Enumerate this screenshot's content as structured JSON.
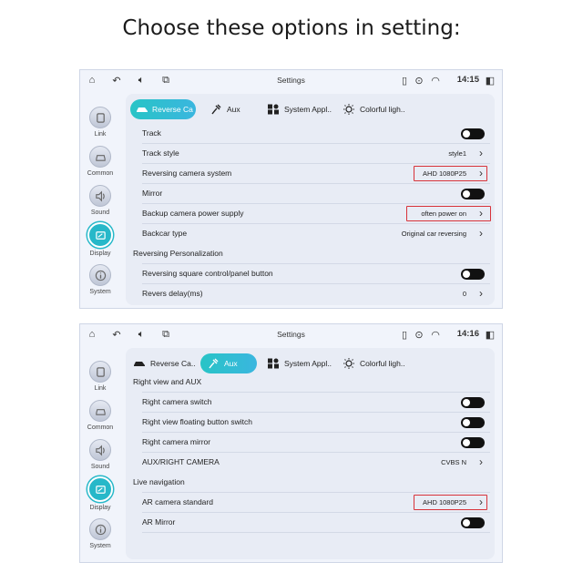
{
  "caption": "Choose these options in setting:",
  "colors": {
    "accent": "#27b8c9",
    "highlight": "#d8333a"
  },
  "sidebar": [
    {
      "label": "Link",
      "icon": "link-icon"
    },
    {
      "label": "Common",
      "icon": "car-icon"
    },
    {
      "label": "Sound",
      "icon": "speaker-icon"
    },
    {
      "label": "Display",
      "icon": "display-icon",
      "active": true
    },
    {
      "label": "System",
      "icon": "info-icon"
    }
  ],
  "screens": [
    {
      "status": {
        "title": "Settings",
        "time": "14:15"
      },
      "tabs": [
        {
          "label": "Reverse Ca",
          "icon": "car-icon",
          "active": true
        },
        {
          "label": "Aux",
          "icon": "plug-icon"
        },
        {
          "label": "System Appl..",
          "icon": "apps-icon"
        },
        {
          "label": "Colorful ligh..",
          "icon": "light-icon"
        }
      ],
      "rows": [
        {
          "label": "Track",
          "control": "toggle"
        },
        {
          "label": "Track style",
          "value": "style1",
          "control": "chevron"
        },
        {
          "label": "Reversing camera system",
          "value": "AHD 1080P25",
          "control": "chevron",
          "highlighted": true
        },
        {
          "label": "Mirror",
          "control": "toggle"
        },
        {
          "label": "Backup camera power supply",
          "value": "often power on",
          "control": "chevron",
          "highlighted": true
        },
        {
          "label": "Backcar type",
          "value": "Original car reversing",
          "control": "chevron"
        },
        {
          "label": "Reversing Personalization",
          "section": true
        },
        {
          "label": "Reversing square control/panel button",
          "control": "toggle"
        },
        {
          "label": "Revers delay(ms)",
          "value": "0",
          "control": "chevron"
        }
      ]
    },
    {
      "status": {
        "title": "Settings",
        "time": "14:16"
      },
      "tabs": [
        {
          "label": "Reverse Ca..",
          "icon": "car-icon"
        },
        {
          "label": "Aux",
          "icon": "plug-icon",
          "active": true
        },
        {
          "label": "System Appl..",
          "icon": "apps-icon"
        },
        {
          "label": "Colorful ligh..",
          "icon": "light-icon"
        }
      ],
      "rows": [
        {
          "label": "Right view and AUX",
          "section": true
        },
        {
          "label": "Right camera switch",
          "control": "toggle"
        },
        {
          "label": "Right view floating button switch",
          "control": "toggle"
        },
        {
          "label": "Right camera mirror",
          "control": "toggle"
        },
        {
          "label": "AUX/RIGHT CAMERA",
          "value": "CVBS N",
          "control": "chevron"
        },
        {
          "label": "Live navigation",
          "section": true
        },
        {
          "label": "AR camera standard",
          "value": "AHD 1080P25",
          "control": "chevron",
          "highlighted": true
        },
        {
          "label": "AR Mirror",
          "control": "toggle"
        }
      ]
    }
  ]
}
